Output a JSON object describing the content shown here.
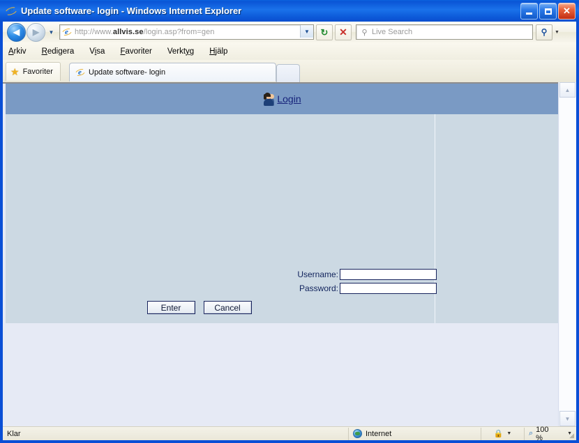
{
  "window": {
    "title": "Update software- login - Windows Internet Explorer",
    "icon": "ie-logo-icon",
    "controls": {
      "minimize": "minimize-button",
      "maximize": "maximize-button",
      "close": "close-button",
      "close_glyph": "✕"
    }
  },
  "toolbar": {
    "back": "back-button",
    "back_glyph": "◀",
    "forward": "forward-button",
    "forward_glyph": "▶",
    "history_caret": "▼",
    "address": {
      "url_prefix": "http://www.",
      "url_domain": "allvis.se",
      "url_suffix": "/login.asp?from=gen",
      "full_url": "http://www.allvis.se/login.asp?from=gen",
      "dropdown_caret": "▼"
    },
    "refresh_glyph": "↻",
    "stop_glyph": "✕",
    "search": {
      "placeholder": "Live Search",
      "magnifier": "⚲",
      "go_glyph": "⚲",
      "dropdown_caret": "▼"
    }
  },
  "menubar": {
    "items": [
      {
        "pre": "",
        "accel": "A",
        "post": "rkiv"
      },
      {
        "pre": "",
        "accel": "R",
        "post": "edigera"
      },
      {
        "pre": "V",
        "accel": "i",
        "post": "sa"
      },
      {
        "pre": "",
        "accel": "F",
        "post": "avoriter"
      },
      {
        "pre": "Verkt",
        "accel": "y",
        "post": "g"
      },
      {
        "pre": "",
        "accel": "H",
        "post": "jälp"
      }
    ]
  },
  "tabbar": {
    "favorites_label": "Favoriter",
    "favorites_icon": "star-icon",
    "tab_label": "Update software- login",
    "tab_icon": "ie-logo-icon",
    "new_tab": "new-tab-button"
  },
  "page": {
    "header": {
      "icon": "users-avatar-icon",
      "link_label": "Login"
    },
    "form": {
      "username_label": "Username:",
      "username_value": "",
      "password_label": "Password:",
      "password_value": "",
      "enter_label": "Enter",
      "cancel_label": "Cancel"
    },
    "colors": {
      "banner": "#7a9ac4",
      "panel": "#ccd9e3",
      "background": "#e6eaf5",
      "link": "#16227a"
    }
  },
  "scrollbar": {
    "up_glyph": "▲",
    "down_glyph": "▼"
  },
  "statusbar": {
    "status": "Klar",
    "zone_icon": "globe-icon",
    "zone": "Internet",
    "protected_icon": "protected-mode-icon",
    "protected_caret": "▼",
    "zoom_icon": "zoom-magnifier-icon",
    "zoom_level": "100 %",
    "zoom_caret": "▼"
  }
}
